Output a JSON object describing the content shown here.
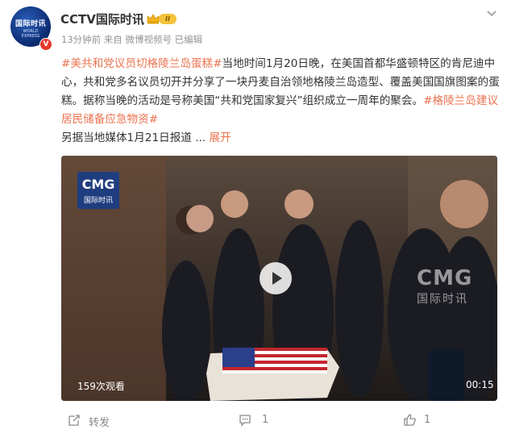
{
  "header": {
    "username": "CCTV国际时讯",
    "level_badge": "II",
    "avatar_text_main": "国际时讯",
    "avatar_text_sub": "WORLD EXPRESS",
    "verified_mark": "V",
    "time": "13分钟前",
    "source": "来自 微博视频号",
    "edited": "已编辑"
  },
  "post": {
    "hashtag1": "#美共和党议员切格陵兰岛蛋糕#",
    "text1": "当地时间1月20日晚，在美国首都华盛顿特区的肯尼迪中心，共和党多名议员切开并分享了一块丹麦自治领地格陵兰岛造型、覆盖美国国旗图案的蛋糕。据称当晚的活动是号称美国“共和党国家复兴”组织成立一周年的聚会。",
    "hashtag2": "#格陵兰岛建议居民储备应急物资#",
    "text2": "另据当地媒体1月21日报道 ...",
    "expand_label": "展开"
  },
  "video": {
    "logo_title": "CMG",
    "logo_sub": "国际时讯",
    "watermark_title": "CMG",
    "watermark_sub": "国际时讯",
    "views": "159次观看",
    "duration": "00:15"
  },
  "actions": {
    "share_label": "转发",
    "comment_count": "1",
    "like_count": "1"
  },
  "colors": {
    "accent": "#eb7350",
    "verified": "#e8392d"
  },
  "icons": [
    "crown-icon",
    "chevron-down-icon",
    "play-icon",
    "share-icon",
    "comment-icon",
    "like-icon"
  ]
}
